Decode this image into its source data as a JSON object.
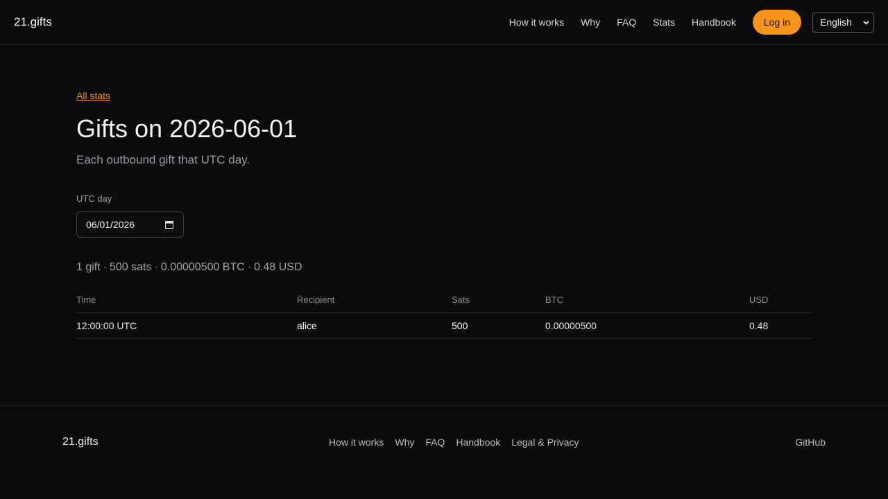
{
  "header": {
    "brand": "21.gifts",
    "nav": [
      "How it works",
      "Why",
      "FAQ",
      "Stats",
      "Handbook"
    ],
    "login_label": "Log in",
    "language": "English"
  },
  "main": {
    "back_link": "All stats",
    "title": "Gifts on 2026-06-01",
    "subtitle": "Each outbound gift that UTC day.",
    "day_label": "UTC day",
    "day_value": "06/01/2026",
    "summary": [
      "1 gift",
      "500 sats",
      "0.00000500 BTC",
      "0.48 USD"
    ],
    "table": {
      "columns": [
        "Time",
        "Recipient",
        "Sats",
        "BTC",
        "USD"
      ],
      "rows": [
        [
          "12:00:00 UTC",
          "alice",
          "500",
          "0.00000500",
          "0.48"
        ]
      ]
    }
  },
  "footer": {
    "brand": "21.gifts",
    "links": [
      "How it works",
      "Why",
      "FAQ",
      "Handbook",
      "Legal & Privacy"
    ],
    "github": "GitHub"
  },
  "colors": {
    "background": "#0b0b0d",
    "accent": "#f7931a"
  }
}
